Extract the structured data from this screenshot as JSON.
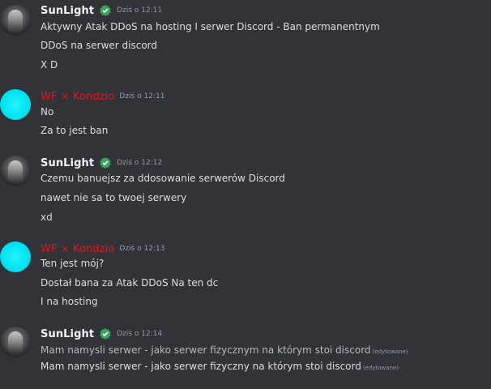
{
  "messages": [
    {
      "username": "SunLight",
      "timestamp": "Dziś o 12:11",
      "lines": [
        "Aktywny Atak DDoS na hosting I serwer Discord - Ban permanentnym",
        "DDoS na serwer discord",
        "X D"
      ]
    },
    {
      "username": "WF × Kondzio",
      "timestamp": "Dziś o 12:11",
      "lines": [
        "No",
        "Za to jest ban"
      ]
    },
    {
      "username": "SunLight",
      "timestamp": "Dziś o 12:12",
      "lines": [
        "Czemu banuejsz za ddosowanie serwerów Discord",
        "nawet nie sa to twoej serwery",
        "xd"
      ]
    },
    {
      "username": "WF × Kondzio",
      "timestamp": "Dziś o 12:13",
      "lines": [
        "Ten jest mój?",
        "Dostał bana za Atak DDoS Na ten dc",
        "I na hosting"
      ]
    },
    {
      "username": "SunLight",
      "timestamp": "Dziś o 12:14",
      "lines": [
        "Mam namysli serwer - jako serwer fizycznym na którym stoi discord",
        "Mam namysli serwer - jako serwer fizyczny na którym stoi discord"
      ],
      "edited_label": "(edytowane)"
    }
  ],
  "colors": {
    "background": "#313338",
    "text": "#dbdee1",
    "username_default": "#f2f3f5",
    "username_red": "#e0151e",
    "timestamp": "#949ba4",
    "badge_green": "#3ba55d",
    "avatar_cyan": "#00e5f2"
  },
  "icons": {
    "badge": "green-badge-icon"
  }
}
